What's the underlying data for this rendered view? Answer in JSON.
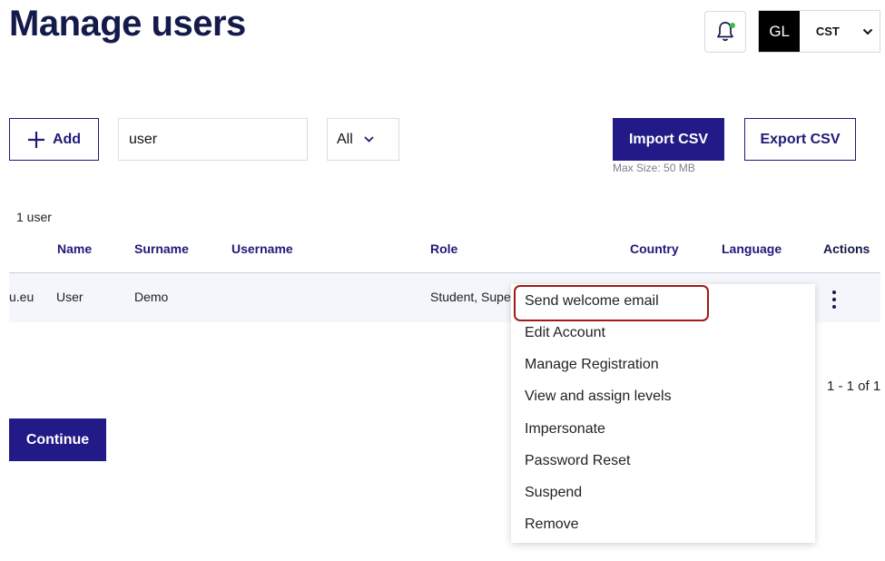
{
  "header": {
    "title": "Manage users",
    "user_initials": "GL",
    "timezone": "CST",
    "notification_dot_color": "#3cc04a"
  },
  "toolbar": {
    "add_label": "Add",
    "search_value": "user",
    "filter_value": "All",
    "import_label": "Import CSV",
    "import_hint": "Max Size: 50 MB",
    "export_label": "Export CSV"
  },
  "table": {
    "count_label": "1 user",
    "columns": [
      "Name",
      "Surname",
      "Username",
      "Role",
      "Country",
      "Language",
      "Actions"
    ],
    "rows": [
      {
        "email_fragment": "u.eu",
        "name": "User",
        "surname": "Demo",
        "username": "",
        "role": "Student, Supe"
      }
    ],
    "pagination": "1 - 1 of 1"
  },
  "actions_menu": {
    "items": [
      "Send welcome email",
      "Edit Account",
      "Manage Registration",
      "View and assign levels",
      "Impersonate",
      "Password Reset",
      "Suspend",
      "Remove"
    ],
    "highlighted_item": "Send welcome email",
    "highlight_color": "#a11a1a"
  },
  "footer": {
    "continue_label": "Continue"
  },
  "colors": {
    "primary": "#221a86",
    "title": "#141a4a"
  }
}
